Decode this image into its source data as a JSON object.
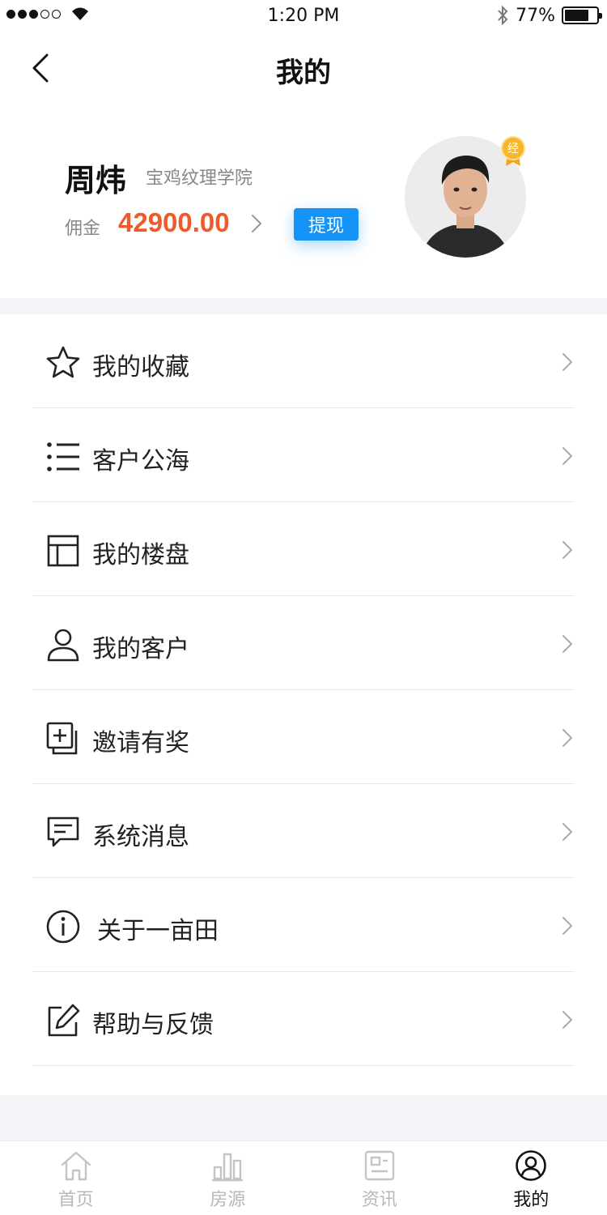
{
  "status_bar": {
    "time": "1:20 PM",
    "battery": "77%",
    "battery_level": 0.77
  },
  "nav": {
    "title": "我的"
  },
  "profile": {
    "name": "周炜",
    "school": "宝鸡纹理学院",
    "commission_label": "佣金",
    "commission_value": "42900.00",
    "withdraw_label": "提现",
    "badge_text": "经"
  },
  "menu": {
    "items": [
      {
        "label": "我的收藏",
        "icon": "star-icon"
      },
      {
        "label": "客户公海",
        "icon": "list-icon"
      },
      {
        "label": "我的楼盘",
        "icon": "layout-icon"
      },
      {
        "label": "我的客户",
        "icon": "user-icon"
      },
      {
        "label": "邀请有奖",
        "icon": "add-copy-icon"
      },
      {
        "label": "系统消息",
        "icon": "message-icon"
      },
      {
        "label": "关于一亩田",
        "icon": "info-icon"
      },
      {
        "label": "帮助与反馈",
        "icon": "edit-icon"
      }
    ]
  },
  "tabs": [
    {
      "label": "首页",
      "icon": "home-icon",
      "active": false
    },
    {
      "label": "房源",
      "icon": "bar-chart-icon",
      "active": false
    },
    {
      "label": "资讯",
      "icon": "news-icon",
      "active": false
    },
    {
      "label": "我的",
      "icon": "profile-icon",
      "active": true
    }
  ],
  "colors": {
    "accent": "#1593f7",
    "commission": "#f05a2a",
    "inactive_tab": "#b8b8b8",
    "background_band": "#f4f5f8"
  }
}
